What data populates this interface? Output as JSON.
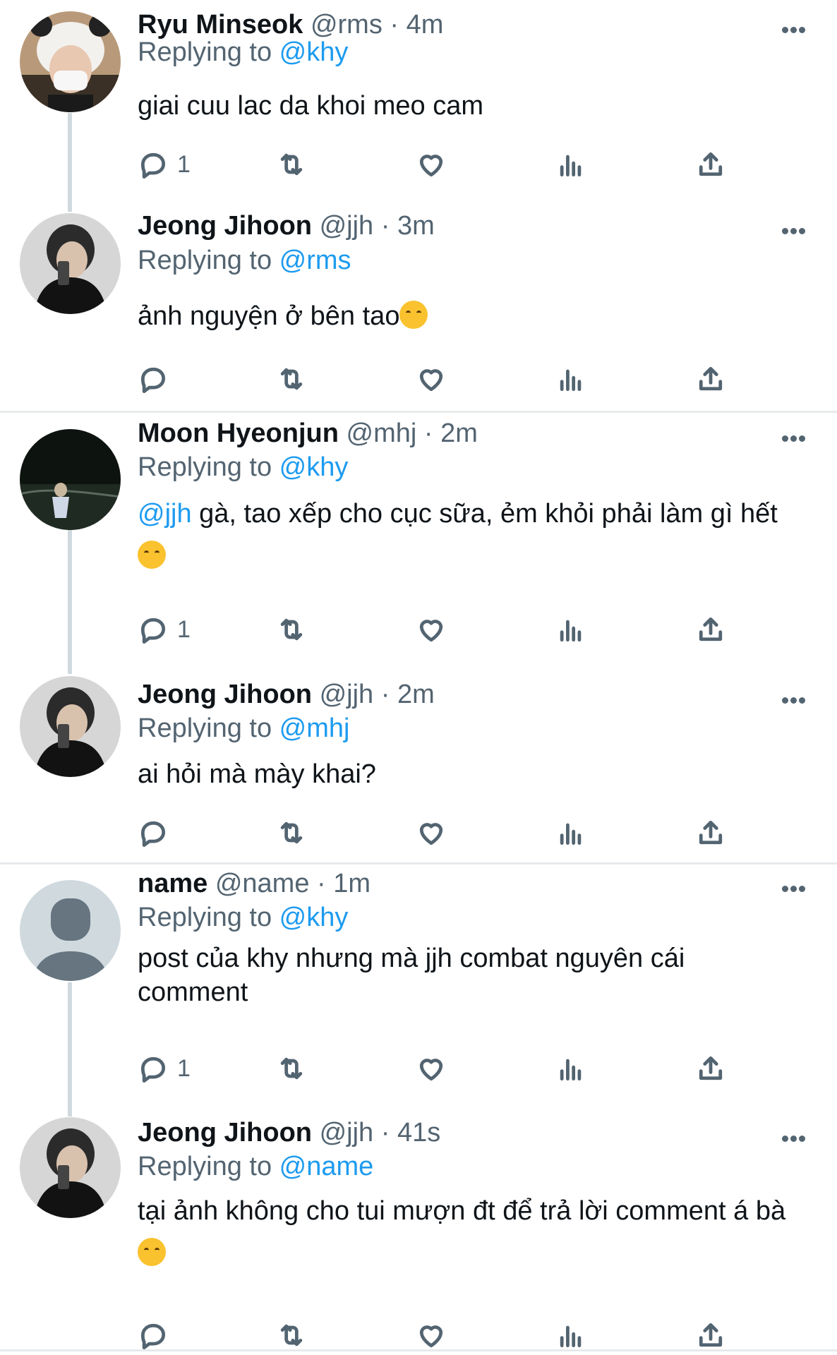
{
  "tweets": [
    {
      "name": "Ryu Minseok",
      "handle": "@rms",
      "time": "4m",
      "replying_prefix": "Replying to ",
      "replying_to": "@khy",
      "text": "giai cuu lac da khoi meo cam",
      "reply_count": "1"
    },
    {
      "name": "Jeong Jihoon",
      "handle": "@jjh",
      "time": "3m",
      "replying_prefix": "Replying to ",
      "replying_to": "@rms",
      "text": "ảnh nguyện ở bên tao",
      "reply_count": ""
    },
    {
      "name": "Moon Hyeonjun",
      "handle": "@mhj",
      "time": "2m",
      "replying_prefix": "Replying to ",
      "replying_to": "@khy",
      "mention": "@jjh",
      "text": " gà, tao xếp cho cục sữa, ẻm khỏi phải làm gì hết",
      "reply_count": "1"
    },
    {
      "name": "Jeong Jihoon",
      "handle": "@jjh",
      "time": "2m",
      "replying_prefix": "Replying to ",
      "replying_to": "@mhj",
      "text": "ai hỏi mà mày khai?",
      "reply_count": ""
    },
    {
      "name": "name",
      "handle": "@name",
      "time": "1m",
      "replying_prefix": "Replying to ",
      "replying_to": "@khy",
      "text": "post của khy nhưng mà jjh combat nguyên cái comment",
      "reply_count": "1"
    },
    {
      "name": "Jeong Jihoon",
      "handle": "@jjh",
      "time": "41s",
      "replying_prefix": "Replying to ",
      "replying_to": "@name",
      "text": "tại ảnh không cho tui mượn đt để trả lời comment á bà",
      "reply_count": ""
    }
  ],
  "separator": " · ",
  "colors": {
    "link": "#1d9bf0",
    "secondary": "#536471",
    "divider": "#e7eaec",
    "thread_line": "#cfd9de"
  },
  "icons": [
    "reply-icon",
    "retweet-icon",
    "like-icon",
    "views-icon",
    "share-icon",
    "more-icon"
  ]
}
